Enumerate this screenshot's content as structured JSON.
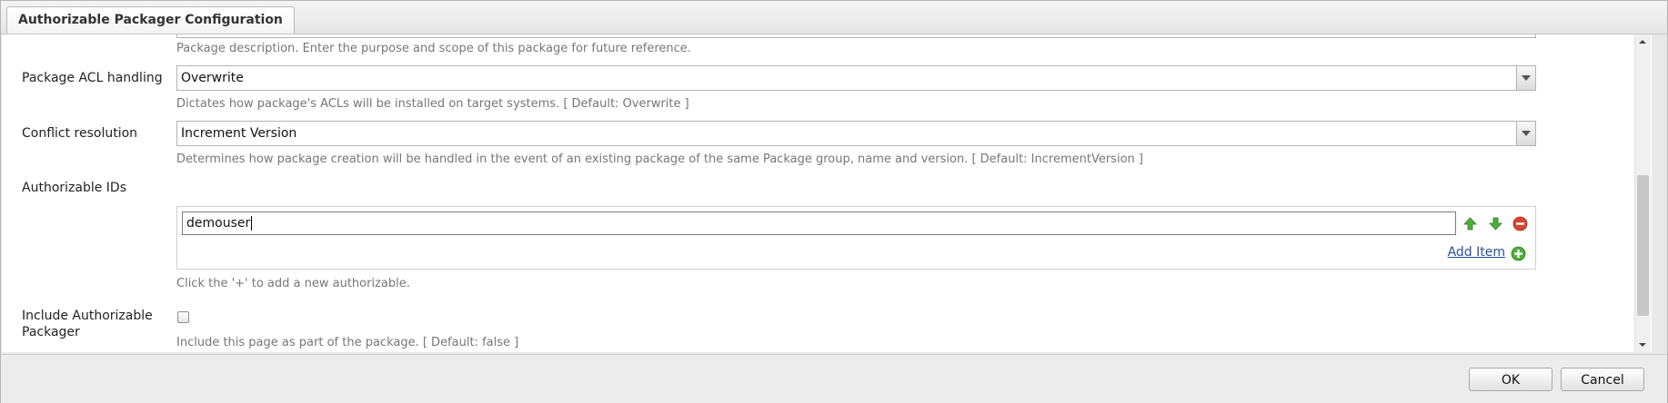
{
  "dialog": {
    "tab_title": "Authorizable Packager Configuration"
  },
  "form": {
    "description_help": "Package description. Enter the purpose and scope of this package for future reference.",
    "acl": {
      "label": "Package ACL handling",
      "value": "Overwrite",
      "help": "Dictates how package's ACLs will be installed on target systems. [ Default: Overwrite ]"
    },
    "conflict": {
      "label": "Conflict resolution",
      "value": "Increment Version",
      "help": "Determines how package creation will be handled in the event of an existing package of the same Package group, name and version. [ Default: IncrementVersion ]"
    },
    "authorizables": {
      "label": "Authorizable IDs",
      "items": [
        "demouser"
      ],
      "add_item_label": "Add Item",
      "help": "Click the '+' to add a new authorizable."
    },
    "include_page": {
      "label_line1": "Include Authorizable",
      "label_line2": "Packager",
      "checked": false,
      "help": "Include this page as part of the package. [ Default: false ]"
    }
  },
  "footer": {
    "ok_label": "OK",
    "cancel_label": "Cancel"
  },
  "icons": {
    "move_up": "arrow-up-icon",
    "move_down": "arrow-down-icon",
    "remove": "remove-icon",
    "add": "add-icon"
  },
  "colors": {
    "icon_green": "#4caf3a",
    "icon_red": "#d64535",
    "link_blue": "#2a4f9b"
  }
}
